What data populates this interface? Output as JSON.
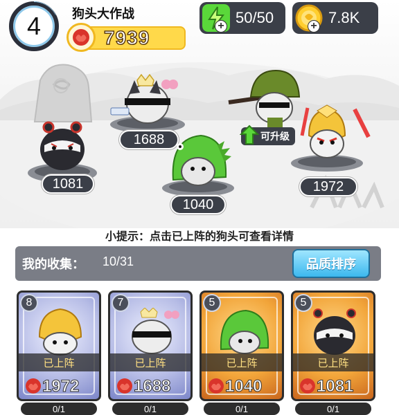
{
  "player": {
    "level": "4",
    "title": "狗头大作战",
    "score": "7939"
  },
  "resources": {
    "energy": "50/50",
    "coins": "7.8K"
  },
  "stage": {
    "platforms": [
      {
        "power": "1081",
        "character": "ninja-dog"
      },
      {
        "power": "1688",
        "character": "sunglasses-dog"
      },
      {
        "power": "1040",
        "character": "dino-dog"
      },
      {
        "power": "1972",
        "character": "golden-armor-dog"
      }
    ],
    "upgrade_label": "可升级",
    "soldier_character": "helmet-soldier-dog"
  },
  "tip": "小提示：点击已上阵的狗头可查看详情",
  "collection": {
    "label": "我的收集：",
    "count": "10/31",
    "sort_button": "品质排序"
  },
  "cards": [
    {
      "level": "8",
      "status": "已上阵",
      "power": "1972",
      "rarity": "purple",
      "progress": "0/1",
      "character": "golden-armor-dog"
    },
    {
      "level": "7",
      "status": "已上阵",
      "power": "1688",
      "rarity": "purple",
      "progress": "0/1",
      "character": "sunglasses-dog"
    },
    {
      "level": "5",
      "status": "已上阵",
      "power": "1040",
      "rarity": "gold",
      "progress": "0/1",
      "character": "dino-dog"
    },
    {
      "level": "5",
      "status": "已上阵",
      "power": "1081",
      "rarity": "gold",
      "progress": "0/1",
      "character": "ninja-dog"
    }
  ],
  "colors": {
    "dark_panel": "#3b3f48",
    "score_yellow": "#ffd94a",
    "sort_blue": "#3cb8ee",
    "power_red": "#d9342b"
  }
}
